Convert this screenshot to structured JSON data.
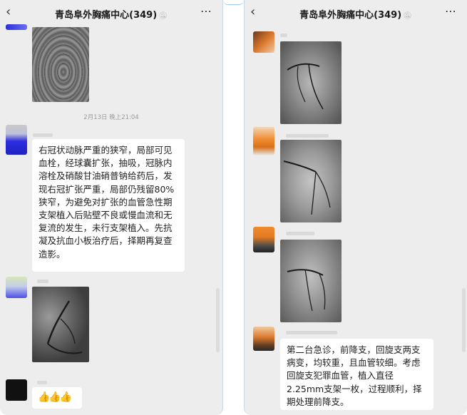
{
  "left": {
    "title": "青岛阜外胸痛中心(349)",
    "mute_icon": "bell-off-icon",
    "back_icon": "chevron-left-icon",
    "more_icon": "more-icon",
    "timestamp": "2月13日 晚上21:04",
    "message_text": "右冠状动脉严重的狭窄，局部可见血栓，经球囊扩张，抽吸，冠脉内溶栓及硝酸甘油硝普钠给药后，发现右冠扩张严重，局部仍残留80%狭窄，为避免对扩张的血管急性期支架植入后贴壁不良或慢血流和无复流的发生，未行支架植入。先抗凝及抗血小板治疗后，择期再复查造影。",
    "reaction_text": "👍👍👍"
  },
  "right": {
    "title": "青岛阜外胸痛中心(349)",
    "mute_icon": "bell-off-icon",
    "back_icon": "chevron-left-icon",
    "more_icon": "more-icon",
    "message_text": "第二台急诊，前降支，回旋支两支病变，均较重，且血管较细。考虑回旋支犯罪血管，植入直径2.25mm支架一枚，过程顺利，择期处理前降支。"
  },
  "colors": {
    "chat_bg": "#ededed",
    "bubble_bg": "#ffffff",
    "divider": "#c9d7e6"
  }
}
